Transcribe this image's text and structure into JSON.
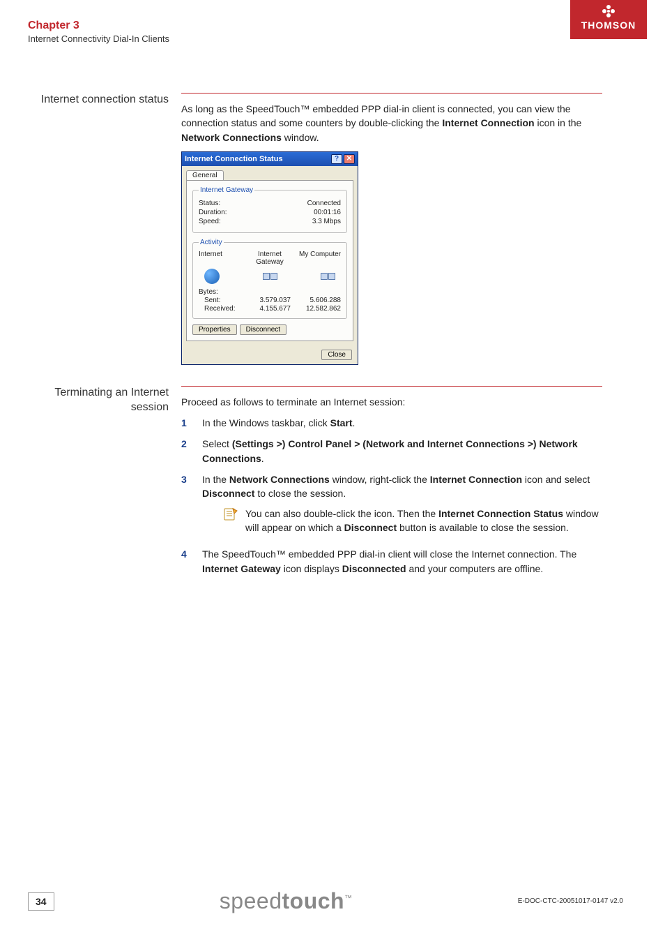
{
  "header": {
    "chapter": "Chapter 3",
    "subtitle": "Internet Connectivity Dial-In Clients",
    "logo_text": "THOMSON"
  },
  "section1": {
    "label": "Internet connection status",
    "para_before": "As long as the SpeedTouch™ embedded PPP dial-in client is connected, you can view the connection status and some counters by double-clicking the ",
    "para_bold1": "Internet Connection",
    "para_mid": " icon in the ",
    "para_bold2": "Network Connections",
    "para_after": " window."
  },
  "dialog": {
    "title": "Internet Connection Status",
    "tab": "General",
    "group1": {
      "legend": "Internet Gateway",
      "status_label": "Status:",
      "status_value": "Connected",
      "duration_label": "Duration:",
      "duration_value": "00:01:16",
      "speed_label": "Speed:",
      "speed_value": "3.3 Mbps"
    },
    "group2": {
      "legend": "Activity",
      "col1": "Internet",
      "col2": "Internet Gateway",
      "col3": "My Computer",
      "bytes_label": "Bytes:",
      "sent_label": "Sent:",
      "sent_gw": "3.579.037",
      "sent_pc": "5.606.288",
      "recv_label": "Received:",
      "recv_gw": "4.155.677",
      "recv_pc": "12.582.862"
    },
    "btn_properties": "Properties",
    "btn_disconnect": "Disconnect",
    "btn_close": "Close"
  },
  "section2": {
    "label": "Terminating an Internet session",
    "intro": "Proceed as follows to terminate an Internet session:",
    "steps": {
      "s1a": "In the Windows taskbar, click ",
      "s1b": "Start",
      "s1c": ".",
      "s2a": "Select ",
      "s2b": "(Settings >) Control Panel > (Network and Internet Connections >) Network Connections",
      "s2c": ".",
      "s3a": "In the ",
      "s3b": "Network Connections",
      "s3c": " window, right-click the ",
      "s3d": "Internet Connection",
      "s3e": " icon and select ",
      "s3f": "Disconnect",
      "s3g": " to close the session.",
      "note_a": "You can also double-click the icon. Then the ",
      "note_b": "Internet Connection Status",
      "note_c": " window will appear on which a ",
      "note_d": "Disconnect",
      "note_e": " button is available to close the session.",
      "s4a": "The SpeedTouch™ embedded PPP dial-in client will close the Internet connection. The ",
      "s4b": "Internet Gateway",
      "s4c": " icon displays ",
      "s4d": "Disconnected",
      "s4e": " and your computers are offline."
    }
  },
  "footer": {
    "page": "34",
    "brand_light": "speed",
    "brand_bold": "touch",
    "brand_tm": "™",
    "docid": "E-DOC-CTC-20051017-0147 v2.0"
  }
}
